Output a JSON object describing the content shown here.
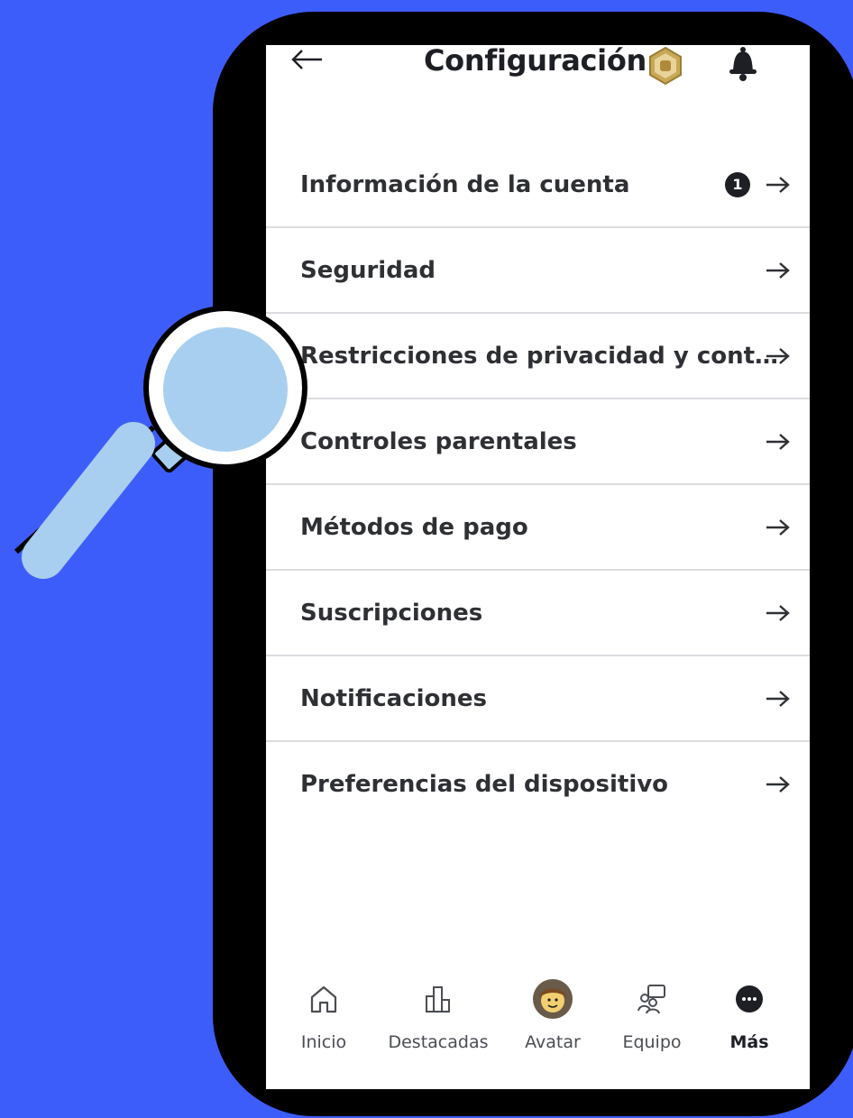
{
  "header": {
    "title": "Configuración",
    "back_icon": "arrow-left-icon",
    "badge_icon": "robux-icon",
    "bell_icon": "bell-icon"
  },
  "menu": {
    "items": [
      {
        "label": "Información de la cuenta",
        "badge": "1"
      },
      {
        "label": "Seguridad"
      },
      {
        "label": "Restricciones de privacidad y cont…"
      },
      {
        "label": "Controles parentales"
      },
      {
        "label": "Métodos de pago"
      },
      {
        "label": "Suscripciones"
      },
      {
        "label": "Notificaciones"
      },
      {
        "label": "Preferencias del dispositivo"
      }
    ],
    "arrow_icon": "arrow-right-icon"
  },
  "tabbar": {
    "tabs": [
      {
        "label": "Inicio",
        "icon": "home-icon"
      },
      {
        "label": "Destacadas",
        "icon": "charts-icon"
      },
      {
        "label": "Avatar",
        "icon": "avatar-icon"
      },
      {
        "label": "Equipo",
        "icon": "team-icon"
      },
      {
        "label": "Más",
        "icon": "more-icon",
        "active": true
      }
    ]
  },
  "colors": {
    "background": "#3d5dfb",
    "magnifier": "#a8cff0",
    "text": "#2e3034",
    "divider": "#dadcdf"
  }
}
